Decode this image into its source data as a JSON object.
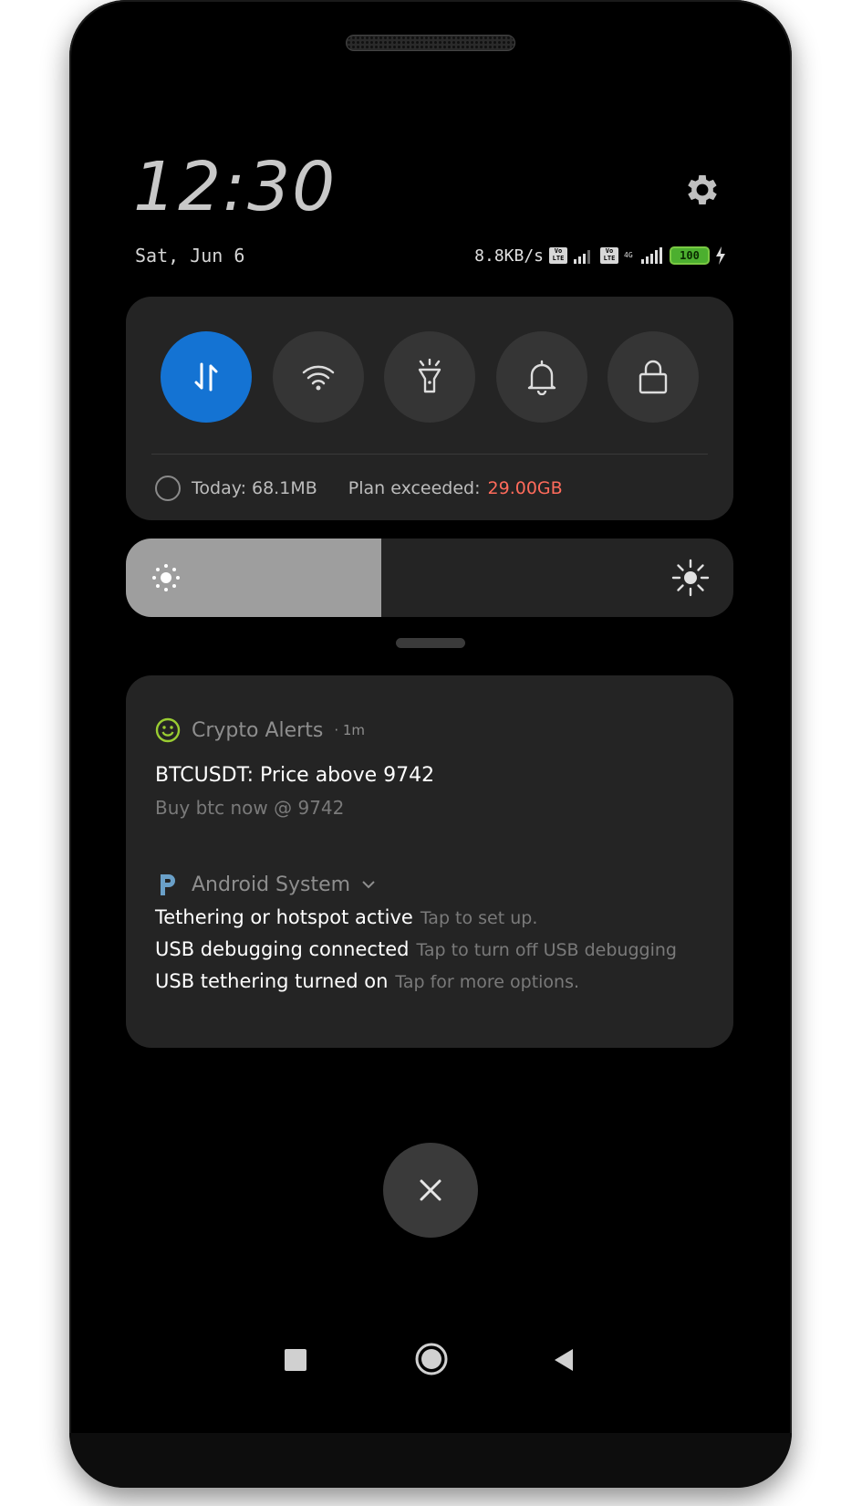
{
  "status": {
    "time": "12:30",
    "date": "Sat, Jun 6",
    "net_speed": "8.8KB/s",
    "battery": "100",
    "network_tag": "4G",
    "volte_label": "Vo LTE"
  },
  "quick_settings": {
    "tiles": [
      {
        "name": "mobile-data",
        "active": true
      },
      {
        "name": "wifi",
        "active": false
      },
      {
        "name": "flashlight",
        "active": false
      },
      {
        "name": "notifications",
        "active": false
      },
      {
        "name": "lock",
        "active": false
      }
    ],
    "usage_today": "Today: 68.1MB",
    "plan_label": "Plan exceeded:",
    "plan_value": "29.00GB"
  },
  "brightness": {
    "level": 0.42
  },
  "notifications": {
    "crypto": {
      "app": "Crypto Alerts",
      "age": "· 1m",
      "title": "BTCUSDT: Price above 9742",
      "body": "Buy btc now @ 9742"
    },
    "android": {
      "app": "Android System",
      "items": [
        {
          "title": "Tethering or hotspot active",
          "desc": "Tap to set up."
        },
        {
          "title": "USB debugging connected",
          "desc": "Tap to turn off USB debugging"
        },
        {
          "title": "USB tethering turned on",
          "desc": "Tap for more options."
        }
      ]
    }
  },
  "colors": {
    "accent": "#1473d3",
    "warning": "#ff6b5b",
    "panel": "#242424",
    "crypto_icon": "#9acd32",
    "android_icon": "#6aa0c8"
  }
}
